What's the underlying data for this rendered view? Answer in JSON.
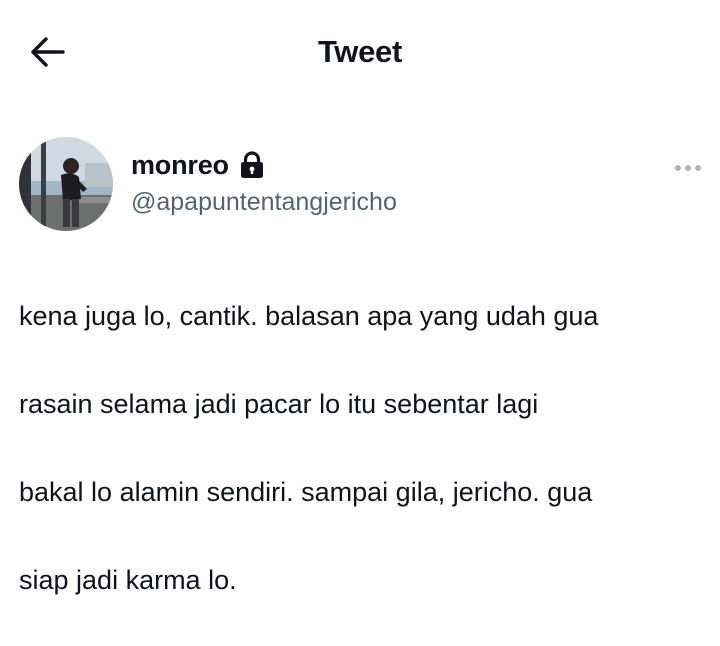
{
  "header": {
    "title": "Tweet",
    "back_icon": "arrow-left-icon"
  },
  "author": {
    "display_name": "monreo",
    "handle": "@apapuntentangjericho",
    "protected_icon": "lock-icon"
  },
  "more_icon": "more-horizontal-icon",
  "tweet": {
    "line1": "kena juga lo, cantik. balasan apa yang udah gua",
    "line2": "rasain selama jadi pacar lo itu sebentar lagi",
    "line3": "bakal lo alamin sendiri. sampai gila, jericho. gua",
    "line4": "siap jadi karma lo."
  },
  "colors": {
    "text": "#0f1419",
    "secondary_text": "#536471",
    "more_dots": "#aab4bd"
  }
}
